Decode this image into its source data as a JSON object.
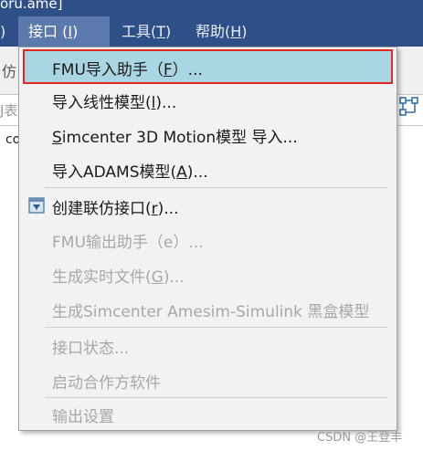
{
  "window": {
    "title_fragment": "oru.ame]"
  },
  "menubar": {
    "items": [
      {
        "label": ")"
      },
      {
        "label": "接口 (",
        "mnemonic": "I",
        "suffix": ")"
      },
      {
        "label": "工具(",
        "mnemonic": "T",
        "suffix": ")"
      },
      {
        "label": "帮助(",
        "mnemonic": "H",
        "suffix": ")"
      }
    ]
  },
  "toolbar": {
    "text_fragment": "仿",
    "row2_fragment": "J表",
    "content_fragment": "co"
  },
  "menu": {
    "items": [
      {
        "prefix": "FMU导入助手（",
        "mnemonic": "F",
        "suffix": "）...",
        "state": "selected"
      },
      {
        "prefix": "导入线性模型(",
        "mnemonic": "l",
        "suffix": ")...",
        "state": "enabled"
      },
      {
        "prefix": "",
        "mnemonic": "S",
        "suffix": "imcenter 3D Motion模型 导入...",
        "state": "enabled"
      },
      {
        "prefix": "导入ADAMS模型(",
        "mnemonic": "A",
        "suffix": ")...",
        "state": "enabled"
      },
      {
        "prefix": "创建联仿接口(",
        "mnemonic": "r",
        "suffix": ")...",
        "state": "enabled",
        "icon": "cosim-interface-icon"
      },
      {
        "prefix": "FMU输出助手（e）...",
        "mnemonic": "",
        "suffix": "",
        "state": "disabled"
      },
      {
        "prefix": "生成实时文件(",
        "mnemonic": "G",
        "suffix": ")...",
        "state": "disabled"
      },
      {
        "prefix": "生成Simcenter Amesim-Simulink 黑盒模型",
        "mnemonic": "",
        "suffix": "",
        "state": "disabled"
      },
      {
        "prefix": "接口状态...",
        "mnemonic": "",
        "suffix": "",
        "state": "disabled"
      },
      {
        "prefix": "启动合作方软件",
        "mnemonic": "",
        "suffix": "",
        "state": "disabled"
      },
      {
        "prefix": "输出设置",
        "mnemonic": "",
        "suffix": "",
        "state": "disabled"
      }
    ]
  },
  "watermark": "CSDN @王登丰",
  "colors": {
    "menubar_bg": "#2e4f88",
    "menu_active_bg": "#5b79ac",
    "selection_bg": "#aad6e4",
    "highlight_border": "#e0281e"
  }
}
